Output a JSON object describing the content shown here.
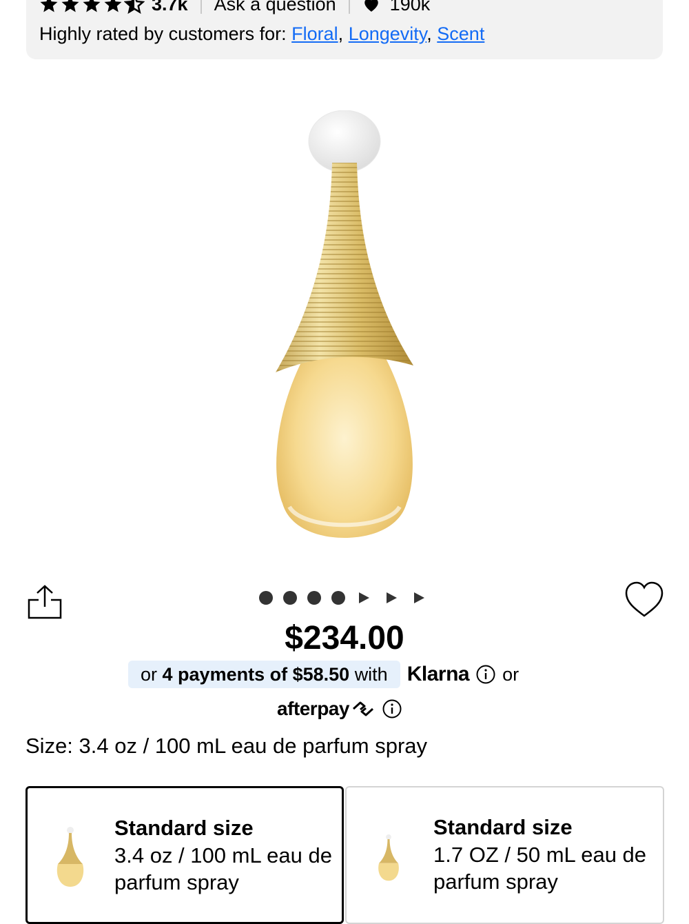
{
  "rating": {
    "count": "3.7k",
    "ask_label": "Ask a question",
    "loves_count": "190k",
    "rated_prefix": "Highly rated by customers for:",
    "tags": [
      "Floral",
      "Longevity",
      "Scent"
    ]
  },
  "gallery": {
    "image_count": 7,
    "dots": 4,
    "video_markers": 3
  },
  "price": {
    "amount": "$234.00",
    "klarna_or": "or",
    "klarna_bold": "4 payments of $58.50",
    "klarna_with": "with",
    "klarna_brand": "Klarna",
    "or_text": "or",
    "afterpay_brand": "afterpay"
  },
  "size": {
    "label": "Size: 3.4 oz / 100 mL eau de parfum spray",
    "options": [
      {
        "title": "Standard size",
        "description": "3.4 oz / 100 mL eau de parfum spray",
        "selected": true
      },
      {
        "title": "Standard size",
        "description": "1.7 OZ / 50 mL eau de parfum spray",
        "selected": false
      }
    ]
  },
  "colors": {
    "link": "#136bf5",
    "klarna_pill": "#e6f0fb",
    "panel": "#f2f2f2"
  }
}
